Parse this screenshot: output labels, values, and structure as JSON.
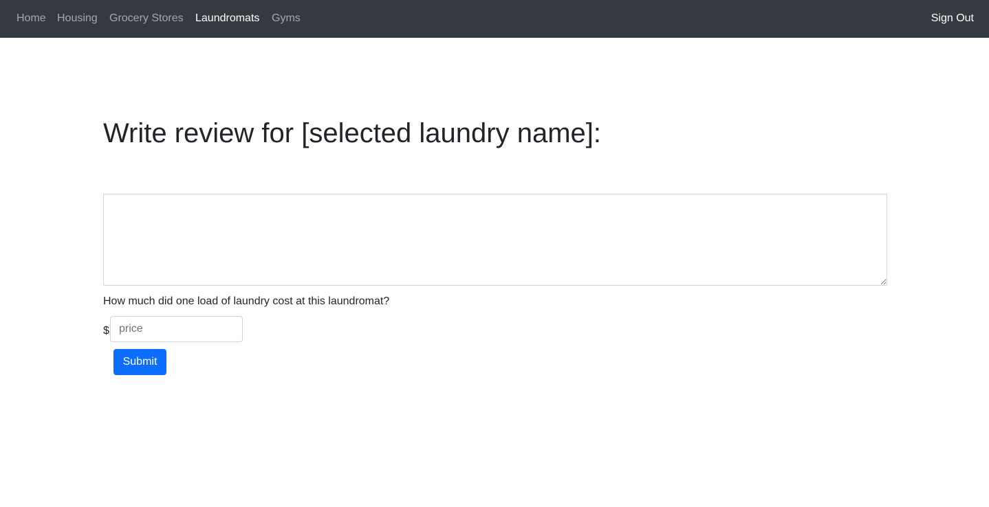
{
  "navbar": {
    "items": [
      {
        "label": "Home",
        "active": false
      },
      {
        "label": "Housing",
        "active": false
      },
      {
        "label": "Grocery Stores",
        "active": false
      },
      {
        "label": "Laundromats",
        "active": true
      },
      {
        "label": "Gyms",
        "active": false
      }
    ],
    "sign_out_label": "Sign Out",
    "background_color": "#343a40"
  },
  "main": {
    "title": "Write review for [selected laundry name]:",
    "review_text": "",
    "cost_question": "How much did one load of laundry cost at this laundromat?",
    "currency_symbol": "$",
    "price_value": "",
    "price_placeholder": "price",
    "submit_label": "Submit",
    "accent_color": "#0d6efd"
  }
}
